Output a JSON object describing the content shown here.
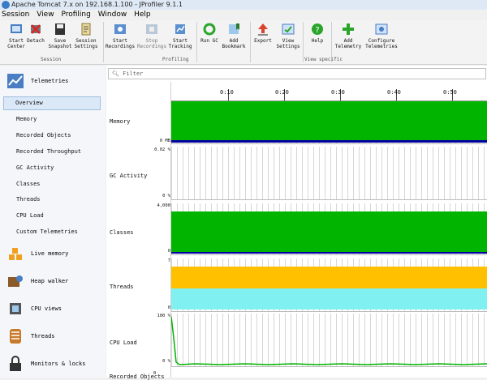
{
  "window": {
    "title": "Apache Tomcat 7.x on 192.168.1.100 - JProfiler 9.1.1"
  },
  "menu": [
    "Session",
    "View",
    "Profiling",
    "Window",
    "Help"
  ],
  "toolbar": {
    "buttons": [
      {
        "label1": "Start",
        "label2": "Center",
        "icon": "start-center-icon"
      },
      {
        "label1": "Detach",
        "label2": "",
        "icon": "detach-icon"
      },
      {
        "label1": "Save",
        "label2": "Snapshot",
        "icon": "save-icon"
      },
      {
        "label1": "Session",
        "label2": "Settings",
        "icon": "session-settings-icon"
      },
      {
        "label1": "Start",
        "label2": "Recordings",
        "icon": "start-recordings-icon"
      },
      {
        "label1": "Stop",
        "label2": "Recordings",
        "icon": "stop-recordings-icon"
      },
      {
        "label1": "Start",
        "label2": "Tracking",
        "icon": "start-tracking-icon"
      },
      {
        "label1": "Run GC",
        "label2": "",
        "icon": "run-gc-icon"
      },
      {
        "label1": "Add",
        "label2": "Bookmark",
        "icon": "bookmark-icon"
      },
      {
        "label1": "Export",
        "label2": "",
        "icon": "export-icon"
      },
      {
        "label1": "View",
        "label2": "Settings",
        "icon": "view-settings-icon"
      },
      {
        "label1": "Help",
        "label2": "",
        "icon": "help-icon"
      },
      {
        "label1": "Add",
        "label2": "Telemetry",
        "icon": "add-telemetry-icon"
      },
      {
        "label1": "Configure",
        "label2": "Telemetries",
        "icon": "configure-icon"
      }
    ],
    "groups": [
      "Session",
      "Profiling",
      "View specific"
    ]
  },
  "sidebar": {
    "telemetries": "Telemetries",
    "items": [
      "Overview",
      "Memory",
      "Recorded Objects",
      "Recorded Throughput",
      "GC Activity",
      "Classes",
      "Threads",
      "CPU Load",
      "Custom Telemetries"
    ],
    "sections": [
      "Live memory",
      "Heap walker",
      "CPU views",
      "Threads",
      "Monitors & locks"
    ]
  },
  "main": {
    "filter_placeholder": "Filter",
    "time_ticks": [
      "0:10",
      "0:20",
      "0:30",
      "0:40",
      "0:50"
    ],
    "rows": [
      {
        "label": "Memory",
        "top_scale": "",
        "bottom_scale": "0 MB"
      },
      {
        "label": "GC Activity",
        "top_scale": "0.02 %",
        "bottom_scale": "0 %"
      },
      {
        "label": "Classes",
        "top_scale": "4,000",
        "bottom_scale": "0"
      },
      {
        "label": "Threads",
        "top_scale": "7",
        "bottom_scale": "0"
      },
      {
        "label": "CPU Load",
        "top_scale": "100 %",
        "bottom_scale": "0 %"
      }
    ],
    "cut_off_row": {
      "label": "Recorded Objects",
      "top_scale": "0"
    }
  },
  "colors": {
    "green": "#00b400",
    "orange": "#ffc000",
    "cyan": "#80f0f0",
    "navy": "#0000a0"
  }
}
